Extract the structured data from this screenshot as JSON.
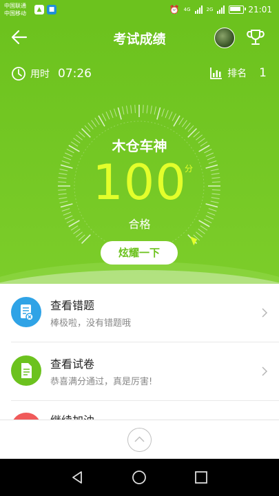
{
  "status_bar": {
    "carrier_1": "中国联通",
    "carrier_2": "中国移动",
    "network_1": "4G",
    "network_2": "2G",
    "time": "21:01"
  },
  "header": {
    "title": "考试成绩"
  },
  "stats": {
    "time_label": "用时",
    "time_value": "07:26",
    "rank_label": "排名",
    "rank_value": "1"
  },
  "result": {
    "username": "木仓车神",
    "score": "100",
    "score_unit": "分",
    "status": "合格",
    "share_label": "炫耀一下"
  },
  "list": [
    {
      "title": "查看错题",
      "subtitle": "棒极啦，没有错题哦",
      "icon": "wrong-questions-icon",
      "color": "#2fa3e6"
    },
    {
      "title": "查看试卷",
      "subtitle": "恭喜满分通过，真是厉害!",
      "icon": "exam-paper-icon",
      "color": "#6cc21e"
    },
    {
      "title": "继续加油",
      "icon": "cheer-icon",
      "color": "#f05a5a"
    }
  ],
  "colors": {
    "primary_green": "#6cc21e",
    "score_yellow": "#e3ff2b"
  }
}
